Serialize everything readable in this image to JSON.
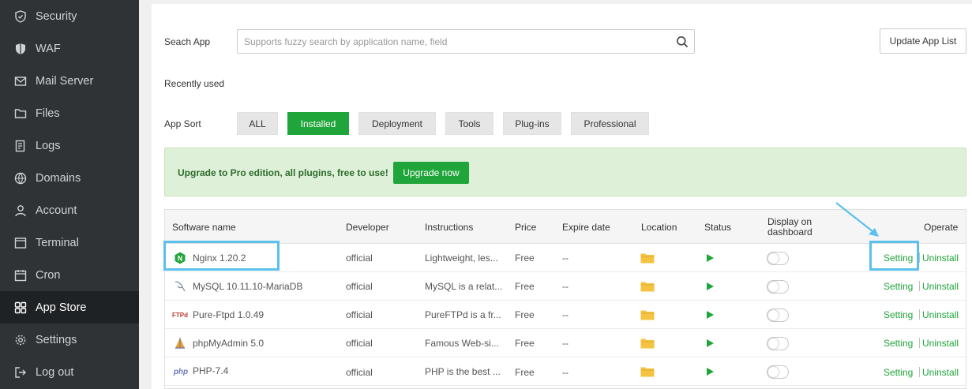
{
  "sidebar": {
    "items": [
      {
        "label": "Security",
        "icon": "shield-icon"
      },
      {
        "label": "WAF",
        "icon": "waf-shield-icon"
      },
      {
        "label": "Mail Server",
        "icon": "mail-icon"
      },
      {
        "label": "Files",
        "icon": "folder-icon"
      },
      {
        "label": "Logs",
        "icon": "logs-icon"
      },
      {
        "label": "Domains",
        "icon": "globe-icon"
      },
      {
        "label": "Account",
        "icon": "user-icon"
      },
      {
        "label": "Terminal",
        "icon": "terminal-icon"
      },
      {
        "label": "Cron",
        "icon": "calendar-icon"
      },
      {
        "label": "App Store",
        "icon": "apps-grid-icon",
        "active": true
      },
      {
        "label": "Settings",
        "icon": "gear-icon"
      },
      {
        "label": "Log out",
        "icon": "logout-icon"
      }
    ]
  },
  "search": {
    "label": "Seach App",
    "placeholder": "Supports fuzzy search by application name, field",
    "value": ""
  },
  "update_button": "Update App List",
  "recently_used_label": "Recently used",
  "app_sort": {
    "label": "App Sort",
    "options": [
      "ALL",
      "Installed",
      "Deployment",
      "Tools",
      "Plug-ins",
      "Professional"
    ],
    "selected": "Installed"
  },
  "promo": {
    "text": "Upgrade to Pro edition, all plugins, free to use!",
    "button": "Upgrade now"
  },
  "table": {
    "headers": {
      "software": "Software name",
      "developer": "Developer",
      "instructions": "Instructions",
      "price": "Price",
      "expire": "Expire date",
      "location": "Location",
      "status": "Status",
      "display_line1": "Display on",
      "display_line2": "dashboard",
      "operate": "Operate"
    },
    "rows": [
      {
        "name": "Nginx 1.20.2",
        "icon": "nginx-icon",
        "developer": "official",
        "instructions": "Lightweight, les...",
        "price": "Free",
        "expire": "--",
        "setting": "Setting",
        "uninstall": "Uninstall"
      },
      {
        "name": "MySQL 10.11.10-MariaDB",
        "icon": "mysql-icon",
        "developer": "official",
        "instructions": "MySQL is a relat...",
        "price": "Free",
        "expire": "--",
        "setting": "Setting",
        "uninstall": "Uninstall"
      },
      {
        "name": "Pure-Ftpd 1.0.49",
        "icon": "ftp-icon",
        "developer": "official",
        "instructions": "PureFTPd is a fr...",
        "price": "Free",
        "expire": "--",
        "setting": "Setting",
        "uninstall": "Uninstall"
      },
      {
        "name": "phpMyAdmin 5.0",
        "icon": "phpmyadmin-icon",
        "developer": "official",
        "instructions": "Famous Web-si...",
        "price": "Free",
        "expire": "--",
        "setting": "Setting",
        "uninstall": "Uninstall"
      },
      {
        "name": "PHP-7.4",
        "icon": "php-icon",
        "developer": "official",
        "instructions": "PHP is the best ...",
        "price": "Free",
        "expire": "--",
        "setting": "Setting",
        "uninstall": "Uninstall"
      }
    ]
  },
  "icon_text": {
    "ftp": "FTPd",
    "php": "php",
    "nginx": "N"
  },
  "colors": {
    "accent_green": "#20a53a",
    "sidebar_bg": "#2f3336",
    "highlight_blue": "#5bc0eb",
    "folder_yellow": "#f5c342"
  }
}
